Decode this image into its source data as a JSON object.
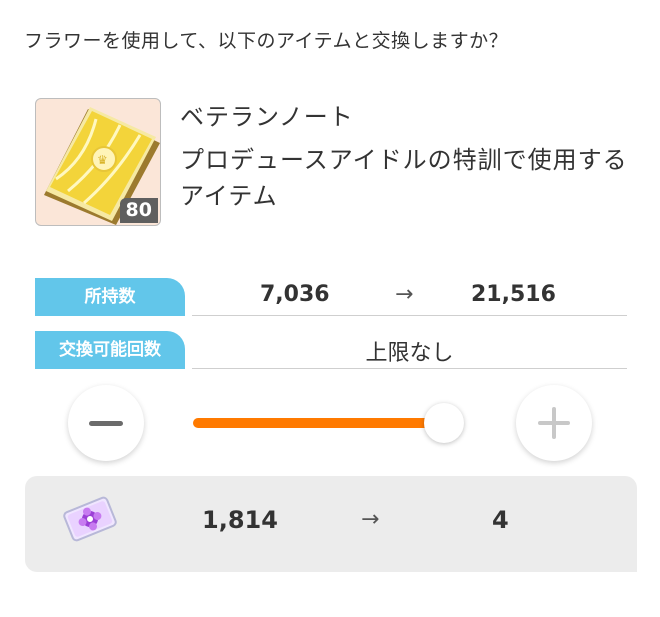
{
  "question": "フラワーを使用して、以下のアイテムと交換しますか？",
  "item": {
    "name": "ベテランノート",
    "description": "プロデュースアイドルの特訓で使用するアイテム",
    "quantity_badge": "80",
    "icon": "veteran-note-book-icon"
  },
  "owned": {
    "label": "所持数",
    "current": "7,036",
    "arrow": "→",
    "after": "21,516"
  },
  "exchange_limit": {
    "label": "交換可能回数",
    "value": "上限なし"
  },
  "slider": {
    "level": 1.0,
    "accent_color": "#ff7a00"
  },
  "cost": {
    "icon": "flower-ticket-icon",
    "current": "1,814",
    "arrow": "→",
    "after": "4"
  },
  "colors": {
    "tag_background": "#62c6ea",
    "panel_background": "#ececec"
  }
}
